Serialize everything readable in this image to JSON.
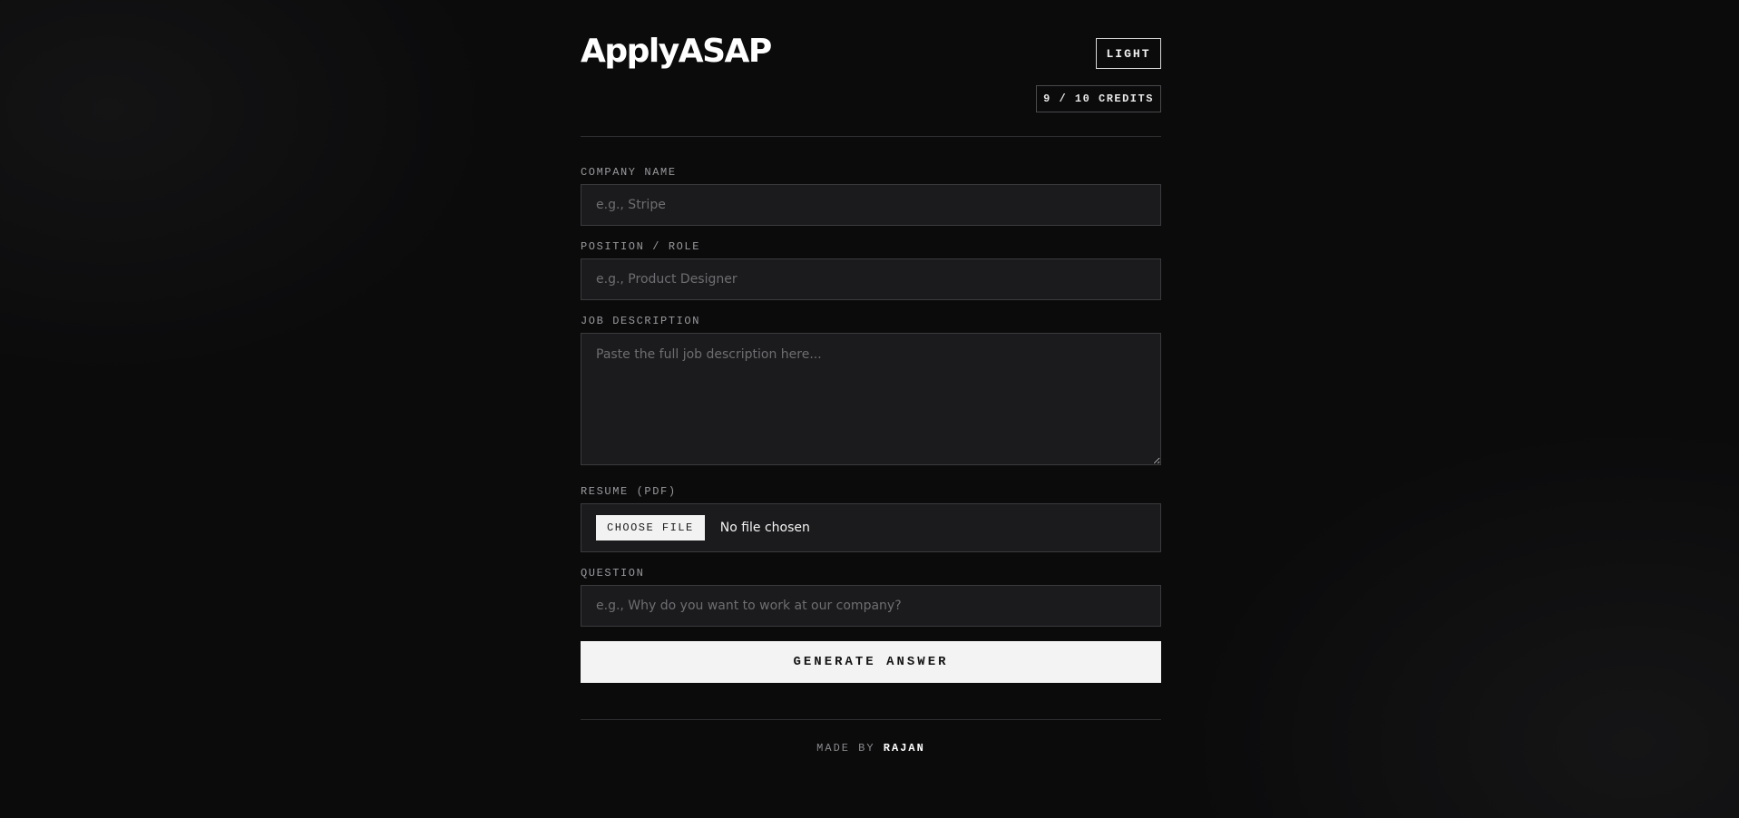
{
  "header": {
    "brand": "ApplyASAP",
    "theme_toggle_label": "LIGHT",
    "credits": "9 / 10 CREDITS"
  },
  "form": {
    "company": {
      "label": "COMPANY NAME",
      "value": "",
      "placeholder": "e.g., Stripe"
    },
    "position": {
      "label": "POSITION / ROLE",
      "value": "",
      "placeholder": "e.g., Product Designer"
    },
    "job_description": {
      "label": "JOB DESCRIPTION",
      "value": "",
      "placeholder": "Paste the full job description here..."
    },
    "resume": {
      "label": "RESUME (PDF)",
      "button_label": "CHOOSE FILE",
      "status": "No file chosen"
    },
    "question": {
      "label": "QUESTION",
      "value": "",
      "placeholder": "e.g., Why do you want to work at our company?"
    },
    "submit_label": "GENERATE ANSWER"
  },
  "footer": {
    "prefix": "MADE BY",
    "author": "RAJAN"
  },
  "colors": {
    "background": "#0b0b0c",
    "field_background": "#1b1b1d",
    "field_border": "#3b3b3e",
    "primary_button": "#f3f3f3"
  }
}
